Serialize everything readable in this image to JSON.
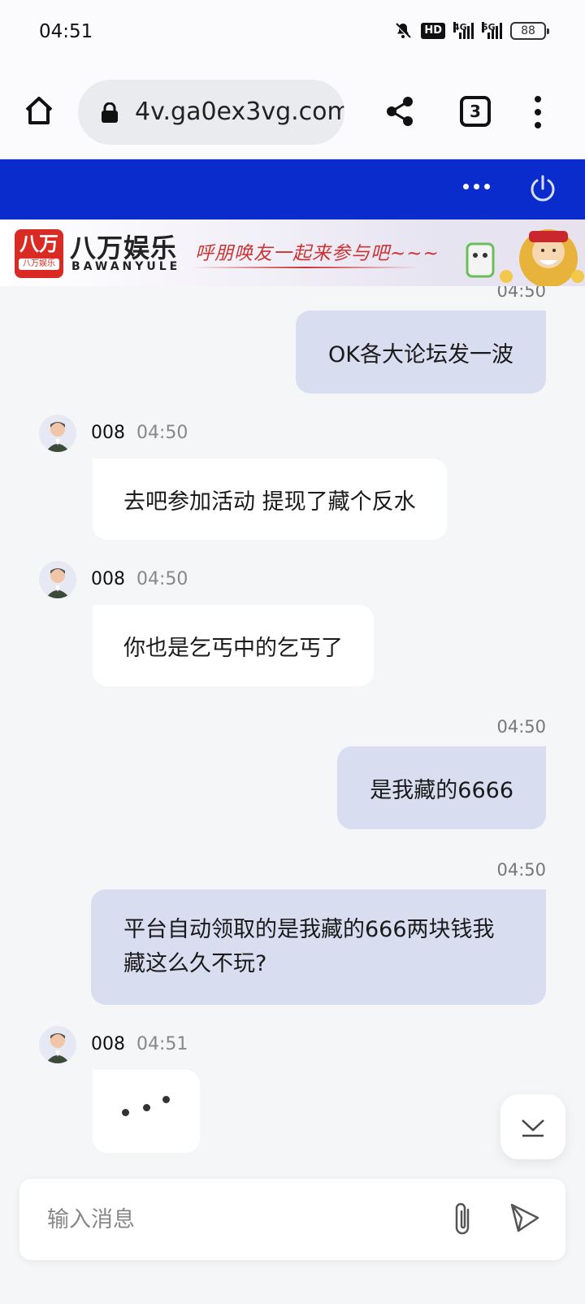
{
  "status_bar": {
    "time": "04:51",
    "hd_label": "HD",
    "net1": "4G",
    "net2": "5G",
    "battery": "88",
    "icons": [
      "bell-off-icon",
      "signal-icon",
      "battery-icon"
    ]
  },
  "browser": {
    "url": "4v.ga0ex3vg.com",
    "tab_count": "3",
    "icons": [
      "home-icon",
      "lock-icon",
      "share-icon",
      "more-vertical-icon"
    ]
  },
  "header": {
    "accent_color": "#0a2ccc",
    "icons": [
      "more-horizontal-icon",
      "power-icon"
    ]
  },
  "banner": {
    "logo_main": "八万",
    "logo_sub": "八万娱乐",
    "brand_cn": "八万娱乐",
    "brand_en": "BAWANYULE",
    "slogan": "呼朋唤友一起来参与吧~~~"
  },
  "messages": {
    "m1": {
      "time": "04:50",
      "text": "OK各大论坛发一波"
    },
    "m2": {
      "sender": "008",
      "time": "04:50",
      "text": "去吧参加活动 提现了藏个反水"
    },
    "m3": {
      "sender": "008",
      "time": "04:50",
      "text": "你也是乞丐中的乞丐了"
    },
    "m4": {
      "time": "04:50",
      "text": "是我藏的6666"
    },
    "m5": {
      "time": "04:50",
      "text": "平台自动领取的是我藏的666两块钱我藏这么久不玩?"
    },
    "m6": {
      "sender": "008",
      "time": "04:51"
    }
  },
  "input": {
    "placeholder": "输入消息",
    "icons": [
      "paperclip-icon",
      "send-icon",
      "chevron-down-icon"
    ]
  }
}
